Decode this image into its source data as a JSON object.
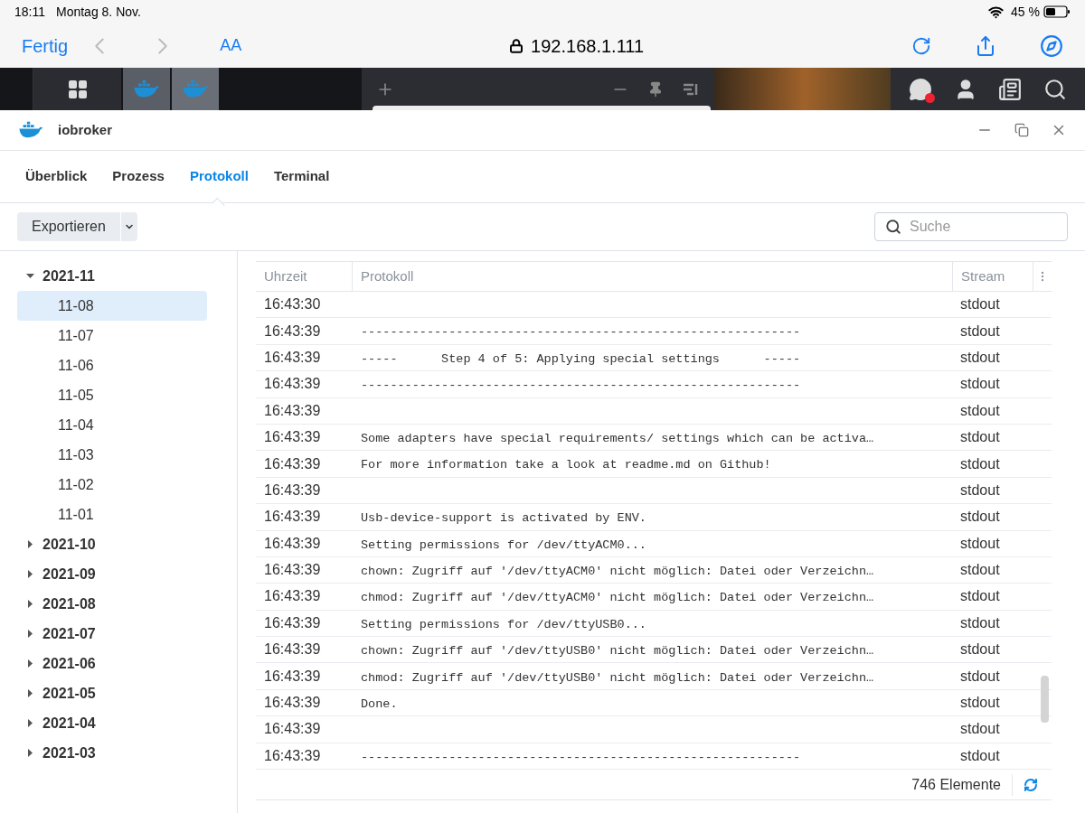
{
  "status_bar": {
    "time": "18:11",
    "date": "Montag 8. Nov.",
    "battery": "45 %"
  },
  "browser": {
    "done": "Fertig",
    "text_size": "AA",
    "url": "192.168.1.111"
  },
  "window": {
    "title": "iobroker"
  },
  "tabs": [
    {
      "label": "Überblick",
      "selected": false
    },
    {
      "label": "Prozess",
      "selected": false
    },
    {
      "label": "Protokoll",
      "selected": true
    },
    {
      "label": "Terminal",
      "selected": false
    }
  ],
  "toolbar": {
    "export": "Exportieren",
    "search_placeholder": "Suche"
  },
  "tree": [
    {
      "label": "2021-11",
      "expanded": true,
      "selected": false,
      "children": [
        {
          "label": "11-08",
          "selected": true
        },
        {
          "label": "11-07",
          "selected": false
        },
        {
          "label": "11-06",
          "selected": false
        },
        {
          "label": "11-05",
          "selected": false
        },
        {
          "label": "11-04",
          "selected": false
        },
        {
          "label": "11-03",
          "selected": false
        },
        {
          "label": "11-02",
          "selected": false
        },
        {
          "label": "11-01",
          "selected": false
        }
      ]
    },
    {
      "label": "2021-10",
      "expanded": false,
      "selected": false
    },
    {
      "label": "2021-09",
      "expanded": false,
      "selected": false
    },
    {
      "label": "2021-08",
      "expanded": false,
      "selected": false
    },
    {
      "label": "2021-07",
      "expanded": false,
      "selected": false
    },
    {
      "label": "2021-06",
      "expanded": false,
      "selected": false
    },
    {
      "label": "2021-05",
      "expanded": false,
      "selected": false
    },
    {
      "label": "2021-04",
      "expanded": false,
      "selected": false
    },
    {
      "label": "2021-03",
      "expanded": false,
      "selected": false
    }
  ],
  "table": {
    "columns": [
      "Uhrzeit",
      "Protokoll",
      "Stream"
    ],
    "rows": [
      {
        "time": "16:43:30",
        "message": "",
        "stream": "stdout"
      },
      {
        "time": "16:43:39",
        "message": "------------------------------------------------------------",
        "stream": "stdout"
      },
      {
        "time": "16:43:39",
        "message": "-----      Step 4 of 5: Applying special settings      -----",
        "stream": "stdout"
      },
      {
        "time": "16:43:39",
        "message": "------------------------------------------------------------",
        "stream": "stdout"
      },
      {
        "time": "16:43:39",
        "message": "",
        "stream": "stdout"
      },
      {
        "time": "16:43:39",
        "message": "Some adapters have special requirements/ settings which can be activa…",
        "stream": "stdout"
      },
      {
        "time": "16:43:39",
        "message": "For more information take a look at readme.md on Github!",
        "stream": "stdout"
      },
      {
        "time": "16:43:39",
        "message": "",
        "stream": "stdout"
      },
      {
        "time": "16:43:39",
        "message": "Usb-device-support is activated by ENV.",
        "stream": "stdout"
      },
      {
        "time": "16:43:39",
        "message": "Setting permissions for /dev/ttyACM0...",
        "stream": "stdout"
      },
      {
        "time": "16:43:39",
        "message": "chown: Zugriff auf '/dev/ttyACM0' nicht möglich: Datei oder Verzeichn…",
        "stream": "stdout"
      },
      {
        "time": "16:43:39",
        "message": "chmod: Zugriff auf '/dev/ttyACM0' nicht möglich: Datei oder Verzeichn…",
        "stream": "stdout"
      },
      {
        "time": "16:43:39",
        "message": "Setting permissions for /dev/ttyUSB0...",
        "stream": "stdout"
      },
      {
        "time": "16:43:39",
        "message": "chown: Zugriff auf '/dev/ttyUSB0' nicht möglich: Datei oder Verzeichn…",
        "stream": "stdout"
      },
      {
        "time": "16:43:39",
        "message": "chmod: Zugriff auf '/dev/ttyUSB0' nicht möglich: Datei oder Verzeichn…",
        "stream": "stdout"
      },
      {
        "time": "16:43:39",
        "message": "Done.",
        "stream": "stdout"
      },
      {
        "time": "16:43:39",
        "message": "",
        "stream": "stdout"
      },
      {
        "time": "16:43:39",
        "message": "------------------------------------------------------------",
        "stream": "stdout"
      }
    ],
    "count": "746 Elemente"
  }
}
